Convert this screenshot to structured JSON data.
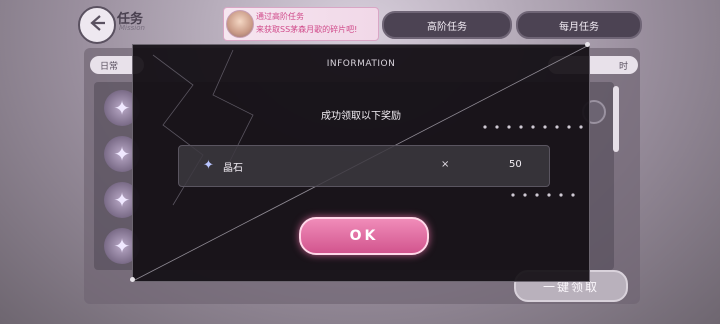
{
  "header": {
    "title": "任务",
    "subtitle": "Mission",
    "notice_line1": "通过高阶任务",
    "notice_line2": "来获取SS茅森月歌的碎片吧!",
    "tab_advanced": "高阶任务",
    "tab_monthly": "每月任务"
  },
  "tabs": {
    "daily": "日常",
    "right_partial": "时"
  },
  "background": {
    "collect_all": "一键领取"
  },
  "modal": {
    "title": "INFORMATION",
    "message": "成功领取以下奖励",
    "reward": {
      "icon": "crystal-icon",
      "name": "晶石",
      "times": "×",
      "quantity": "50"
    },
    "ok_label": "OK"
  },
  "colors": {
    "accent_pink": "#d2558e",
    "notice_text": "#d04a8a",
    "modal_bg": "#120e14"
  }
}
